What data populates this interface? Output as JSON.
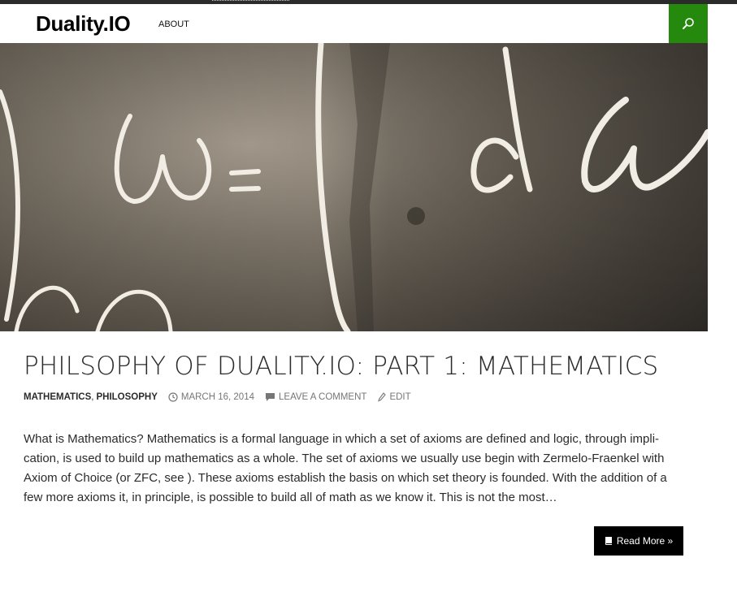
{
  "site": {
    "title": "Duality.IO"
  },
  "nav": {
    "items": [
      {
        "label": "ABOUT"
      }
    ]
  },
  "header": {
    "search_icon": "search-icon",
    "accent_color": "#24890d"
  },
  "post": {
    "title": "PHILSOPHY OF DUALITY.IO: PART 1: MATHEMATICS",
    "categories": [
      "MATHEMATICS",
      "PHILOSOPHY"
    ],
    "category_separator": ",",
    "date": "MARCH 16, 2014",
    "comment_link": "LEAVE A COMMENT",
    "edit_link": "EDIT",
    "summary": "What is Mathematics? Mathematics is a formal language in which a set of axioms are defined and logic, through impli­cation,  is used to build up mathematics as a whole. The set of axioms we usually use begin with Zermelo-Fraenkel with Axiom of Choice (or ZFC, see ). These axioms establish the basis on which set theory is founded. With the addition of a few more axioms it, in principle, is possible to build all of math as we know it. This is not the most…",
    "read_more": "Read More »"
  },
  "icons": {
    "date": "clock-icon",
    "comment": "comment-bubble-icon",
    "edit": "pencil-icon",
    "read_more": "book-icon"
  }
}
